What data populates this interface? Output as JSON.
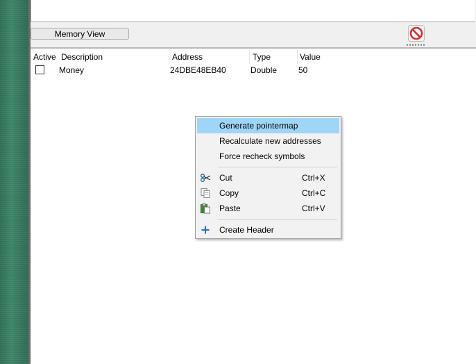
{
  "toolbar": {
    "memory_view_label": "Memory View",
    "stop_icon": "no-entry-icon"
  },
  "address_list": {
    "columns": [
      "Active",
      "Description",
      "Address",
      "Type",
      "Value"
    ],
    "rows": [
      {
        "active": false,
        "description": "Money",
        "address": "24DBE48EB40",
        "type": "Double",
        "value": "50"
      }
    ]
  },
  "context_menu": {
    "items": [
      {
        "label": "Generate pointermap",
        "shortcut": "",
        "icon": "",
        "highlighted": true
      },
      {
        "label": "Recalculate new addresses",
        "shortcut": "",
        "icon": ""
      },
      {
        "label": "Force recheck symbols",
        "shortcut": "",
        "icon": ""
      },
      {
        "label": "Cut",
        "shortcut": "Ctrl+X",
        "icon": "scissors-icon"
      },
      {
        "label": "Copy",
        "shortcut": "Ctrl+C",
        "icon": "copy-icon"
      },
      {
        "label": "Paste",
        "shortcut": "Ctrl+V",
        "icon": "paste-icon"
      },
      {
        "label": "Create Header",
        "shortcut": "",
        "icon": "plus-icon"
      }
    ]
  },
  "colors": {
    "highlight": "#9fd5f7",
    "desktop_green": "#3d8468",
    "stop_red": "#d32f2f"
  }
}
